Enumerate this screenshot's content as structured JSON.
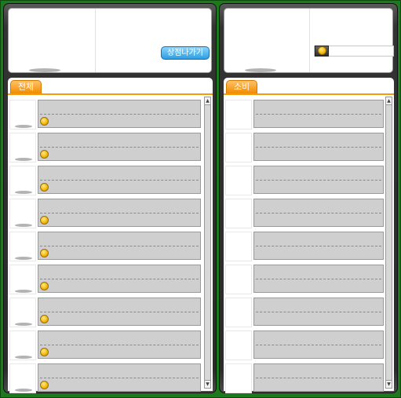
{
  "shop_owner": {
    "exit_button_label": "상점나가기",
    "tab_label": "전체",
    "item_count": 9
  },
  "inventory": {
    "tab_label": "소비",
    "item_count": 9
  },
  "colors": {
    "frame_green": "#1c7a1c",
    "tab_orange": "#f08c00",
    "exit_button_blue": "#2d9ee3",
    "item_box_gray": "#cfcfcf"
  },
  "icons": {
    "meso": "meso-coin-icon",
    "scroll_up": "scroll-up-arrow-icon",
    "scroll_down": "scroll-down-arrow-icon"
  }
}
